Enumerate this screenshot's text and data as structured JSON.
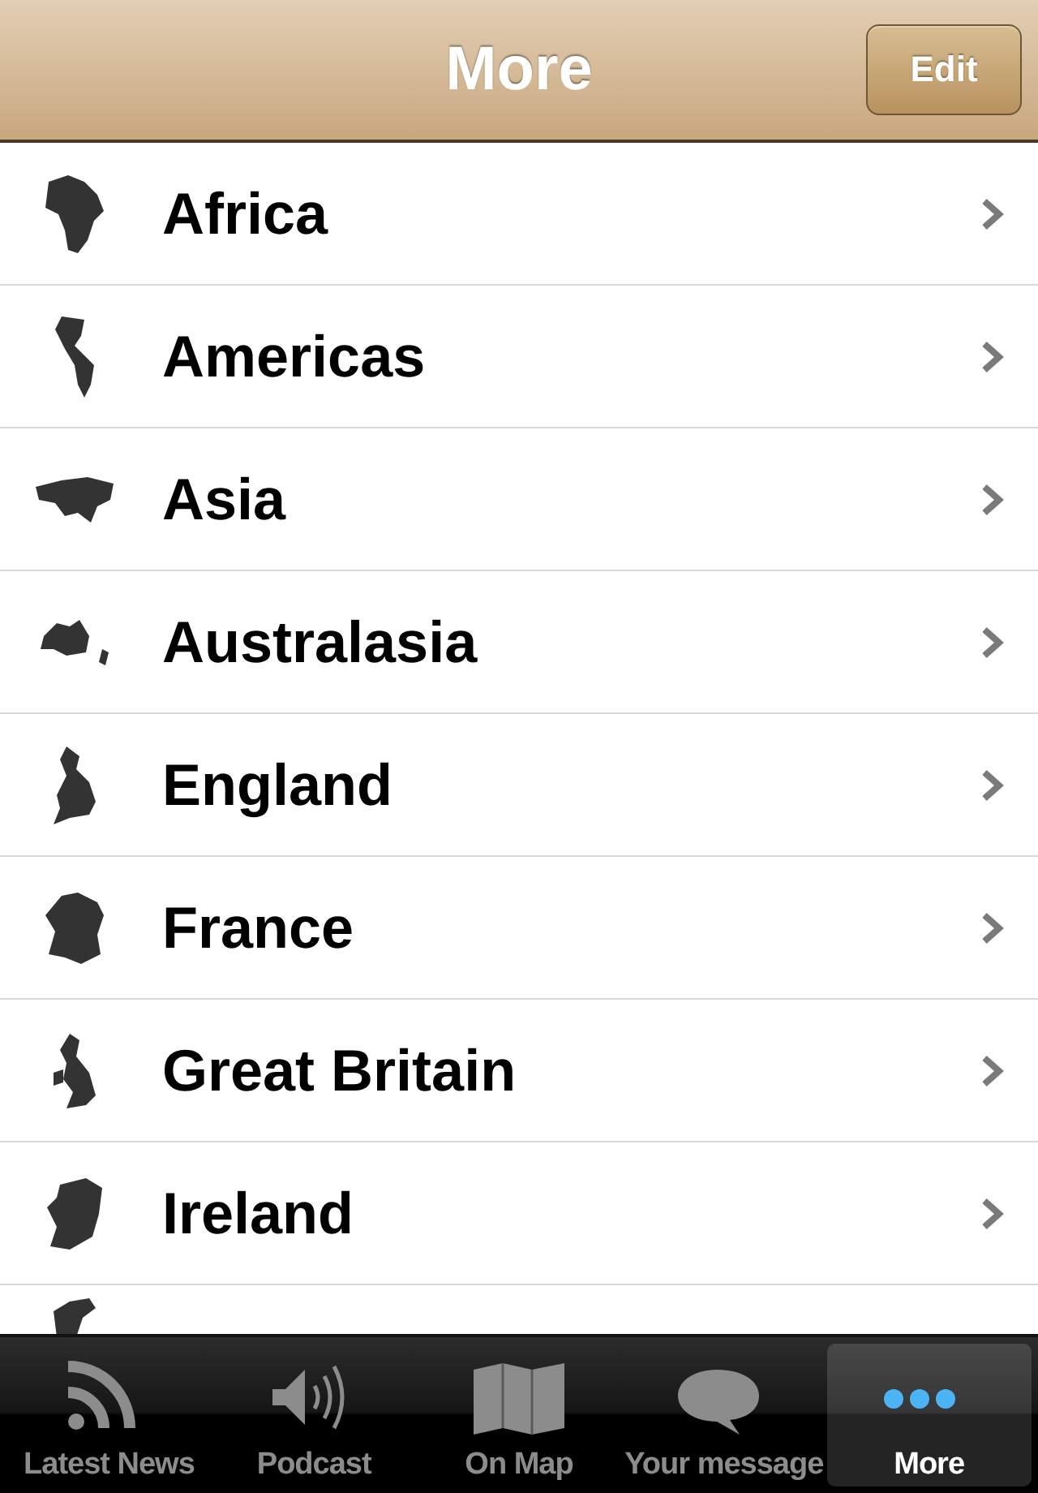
{
  "nav_bar": {
    "title": "More",
    "edit_button": "Edit"
  },
  "list": {
    "items": [
      {
        "label": "Africa"
      },
      {
        "label": "Americas"
      },
      {
        "label": "Asia"
      },
      {
        "label": "Australasia"
      },
      {
        "label": "England"
      },
      {
        "label": "France"
      },
      {
        "label": "Great Britain"
      },
      {
        "label": "Ireland"
      }
    ]
  },
  "tab_bar": [
    {
      "label": "Latest News",
      "kind": "rss",
      "selected": false
    },
    {
      "label": "Podcast",
      "kind": "speaker",
      "selected": false
    },
    {
      "label": "On Map",
      "kind": "map",
      "selected": false
    },
    {
      "label": "Your message",
      "kind": "speech",
      "selected": false
    },
    {
      "label": "More",
      "kind": "dots",
      "selected": true
    }
  ]
}
